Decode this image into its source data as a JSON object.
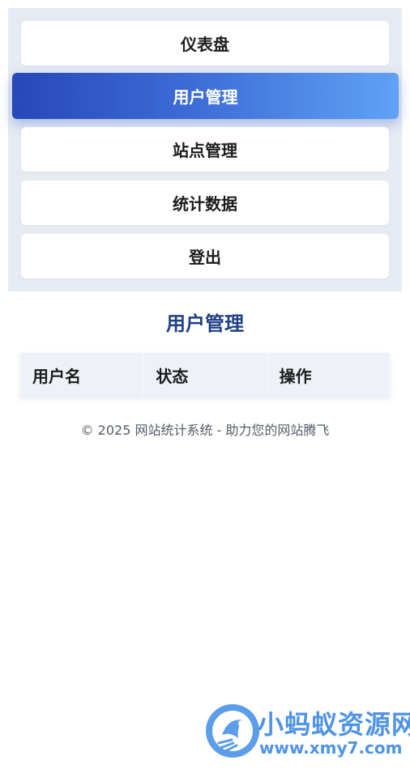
{
  "nav": {
    "items": [
      {
        "label": "仪表盘",
        "active": false
      },
      {
        "label": "用户管理",
        "active": true
      },
      {
        "label": "站点管理",
        "active": false
      },
      {
        "label": "统计数据",
        "active": false
      },
      {
        "label": "登出",
        "active": false
      }
    ]
  },
  "main": {
    "title": "用户管理",
    "table": {
      "headers": [
        "用户名",
        "状态",
        "操作"
      ],
      "rows": []
    }
  },
  "footer": {
    "text": "© 2025 网站统计系统 - 助力您的网站腾飞"
  },
  "watermark": {
    "title": "小蚂蚁资源网",
    "url": "www.xmy7.com"
  },
  "colors": {
    "accent_start": "#2748b8",
    "accent_end": "#5fa2f6",
    "title": "#1f3f86",
    "watermark": "#4f93e6"
  },
  "icons": {
    "watermark_logo": "ant-logo-icon"
  }
}
